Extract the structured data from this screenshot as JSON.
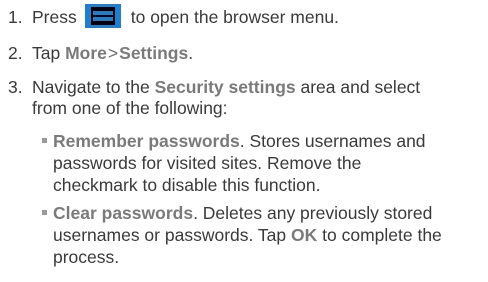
{
  "steps": [
    {
      "num": "1.",
      "pre": "Press",
      "post": "to open the browser menu.",
      "icon": "menu-key-icon"
    },
    {
      "num": "2.",
      "pre": "Tap",
      "kw1": "More",
      "sep": ">",
      "kw2": "Settings",
      "post": "."
    },
    {
      "num": "3.",
      "pre": "Navigate to the",
      "kw": "Security settings",
      "post1": "area and select",
      "line2": "from one of the following:"
    }
  ],
  "bullets": [
    {
      "kw": "Remember passwords",
      "l1": ". Stores usernames and",
      "l2": "passwords for visited sites. Remove the",
      "l3": "checkmark to disable this function."
    },
    {
      "kw": "Clear passwords",
      "l1": ". Deletes any previously stored",
      "l2a": "usernames or passwords. Tap",
      "ok": "OK",
      "l2b": "to complete the",
      "l3": "process."
    }
  ],
  "colors": {
    "menu_key": "#1e7fd1",
    "text": "#3a3a3a",
    "keyword": "#7a7a7a"
  }
}
